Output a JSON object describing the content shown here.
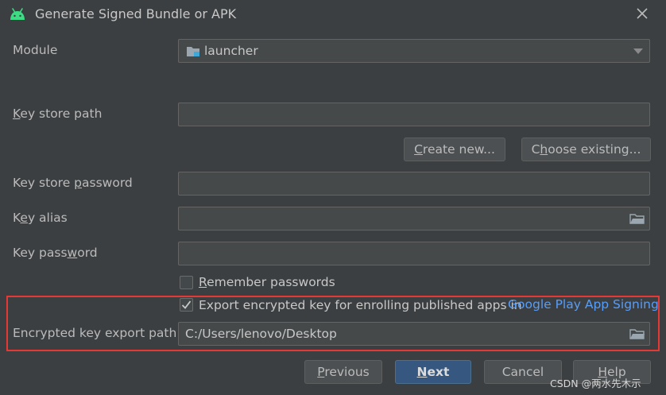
{
  "window": {
    "title": "Generate Signed Bundle or APK"
  },
  "module": {
    "label": "Module",
    "value": "launcher"
  },
  "key_store_path": {
    "label": "Key store path",
    "value": ""
  },
  "buttons": {
    "create_new": "Create new...",
    "choose_existing": "Choose existing..."
  },
  "key_store_password": {
    "label": "Key store password",
    "value": ""
  },
  "key_alias": {
    "label": "Key alias",
    "value": ""
  },
  "key_password": {
    "label": "Key password",
    "value": ""
  },
  "remember_passwords": {
    "label": "Remember passwords",
    "checked": false
  },
  "export_encrypted": {
    "label": "Export encrypted key for enrolling published apps in",
    "link": "Google Play App Signing",
    "checked": true
  },
  "export_path": {
    "label": "Encrypted key export path",
    "value": "C:/Users/lenovo/Desktop"
  },
  "footer": {
    "previous": "Previous",
    "next": "Next",
    "cancel": "Cancel",
    "help": "Help"
  },
  "watermark": "CSDN @两水先木示",
  "colors": {
    "background": "#3c3f41",
    "field_bg": "#45494a",
    "primary_button": "#365880",
    "link": "#589df6",
    "highlight": "#e53935",
    "android_icon": "#3ddc84"
  },
  "icons": [
    "android-icon",
    "close-icon",
    "folder-icon",
    "checkmark-icon",
    "chevron-down-icon"
  ]
}
